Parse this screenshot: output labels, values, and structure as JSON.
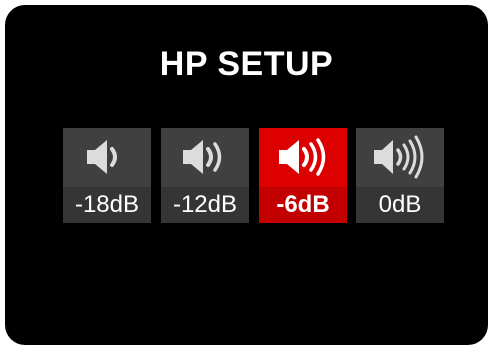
{
  "screen": {
    "title": "HP SETUP"
  },
  "options": [
    {
      "label": "-18dB",
      "icon": "speaker-1-wave-icon",
      "selected": false
    },
    {
      "label": "-12dB",
      "icon": "speaker-2-waves-icon",
      "selected": false
    },
    {
      "label": "-6dB",
      "icon": "speaker-3-waves-icon",
      "selected": true
    },
    {
      "label": "0dB",
      "icon": "speaker-4-waves-icon",
      "selected": false
    }
  ],
  "colors": {
    "background": "#000000",
    "tile": "#404040",
    "selected_tile": "#dd0000",
    "text": "#ffffff"
  }
}
